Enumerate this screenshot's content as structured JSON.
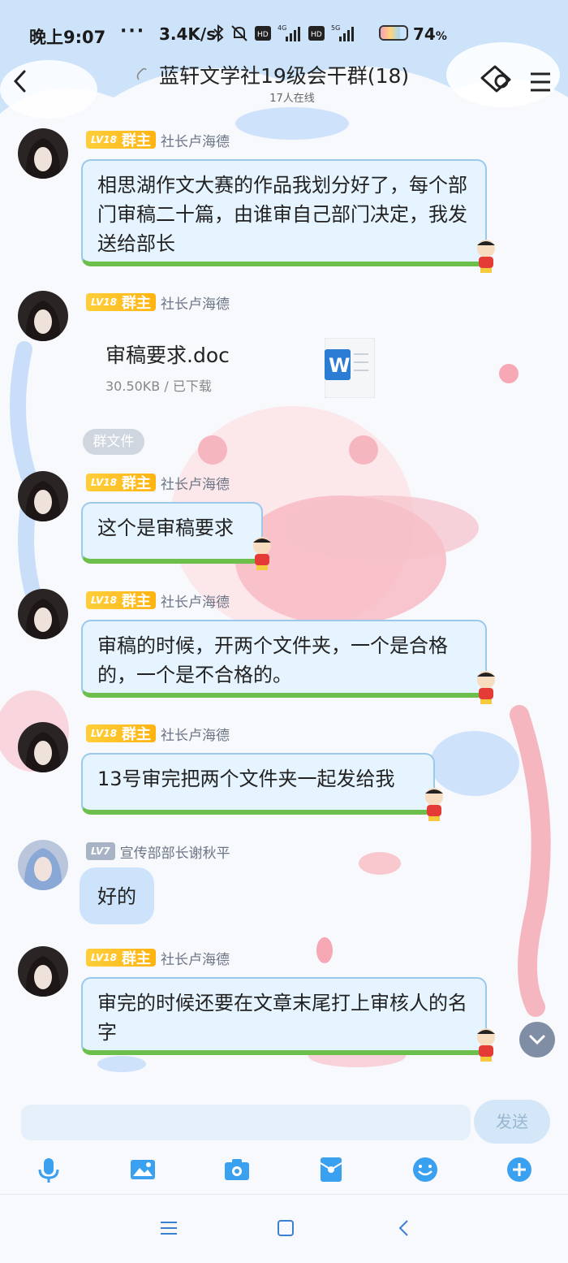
{
  "status_bar": {
    "time": "晚上9:07",
    "dots": "···",
    "speed": "3.4K/s",
    "battery_text": "74",
    "battery_unit": "%",
    "battery_level": 0.74
  },
  "header": {
    "title": "蓝轩文学社19级会干群(18)",
    "online": "17人在线"
  },
  "messages": [
    {
      "level": "LV18",
      "role": "群主",
      "sender": "社长卢海德",
      "text": "相思湖作文大赛的作品我划分好了，每个部门审稿二十篇，由谁审自己部门决定，我发送给部长"
    },
    {
      "level": "LV18",
      "role": "群主",
      "sender": "社长卢海德",
      "file_name": "审稿要求.doc",
      "file_meta": "30.50KB / 已下载",
      "tag": "群文件"
    },
    {
      "level": "LV18",
      "role": "群主",
      "sender": "社长卢海德",
      "text": "这个是审稿要求"
    },
    {
      "level": "LV18",
      "role": "群主",
      "sender": "社长卢海德",
      "text": "审稿的时候，开两个文件夹，一个是合格的，一个是不合格的。"
    },
    {
      "level": "LV18",
      "role": "群主",
      "sender": "社长卢海德",
      "text": "13号审完把两个文件夹一起发给我"
    },
    {
      "level": "LV7",
      "sender": "宣传部部长谢秋平",
      "text": "好的"
    },
    {
      "level": "LV18",
      "role": "群主",
      "sender": "社长卢海德",
      "text": "审完的时候还要在文章末尾打上审核人的名字"
    }
  ],
  "input": {
    "send_label": "发送"
  },
  "icons": [
    "back-icon",
    "group-link-icon",
    "group-settings-icon",
    "menu-icon",
    "mic-icon",
    "image-icon",
    "camera-icon",
    "red-packet-icon",
    "emoji-icon",
    "plus-icon",
    "word-file-icon",
    "chevron-down-icon"
  ],
  "colors": {
    "accent": "#3aa0f0",
    "bubble_bg": "#e6f4ff",
    "bubble_underline": "#6bbf4a",
    "level_gold": "#ffb312"
  }
}
